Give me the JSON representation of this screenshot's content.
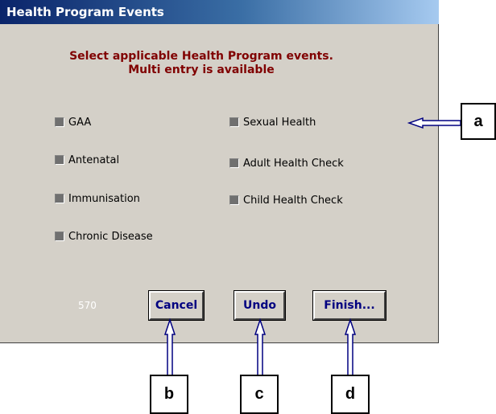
{
  "window": {
    "title": "Health Program Events",
    "instructions": [
      "Select applicable Health Program events.",
      "Multi entry is available"
    ],
    "code": "570"
  },
  "events_left": [
    {
      "label": "GAA",
      "state": "indeterminate"
    },
    {
      "label": "Antenatal",
      "state": "indeterminate"
    },
    {
      "label": "Immunisation",
      "state": "indeterminate"
    },
    {
      "label": "Chronic Disease",
      "state": "indeterminate"
    }
  ],
  "events_right": [
    {
      "label": "Sexual Health",
      "state": "indeterminate"
    },
    {
      "label": "Adult Health Check",
      "state": "indeterminate"
    },
    {
      "label": "Child Health Check",
      "state": "indeterminate"
    }
  ],
  "buttons": {
    "cancel": "Cancel",
    "undo": "Undo",
    "finish": "Finish..."
  },
  "callouts": {
    "a": "a",
    "b": "b",
    "c": "c",
    "d": "d"
  },
  "colors": {
    "title_gradient_start": "#0a246a",
    "title_gradient_end": "#a6caf0",
    "window_bg": "#d4d0c8",
    "instruction_text": "#800000",
    "button_text": "#000080"
  }
}
